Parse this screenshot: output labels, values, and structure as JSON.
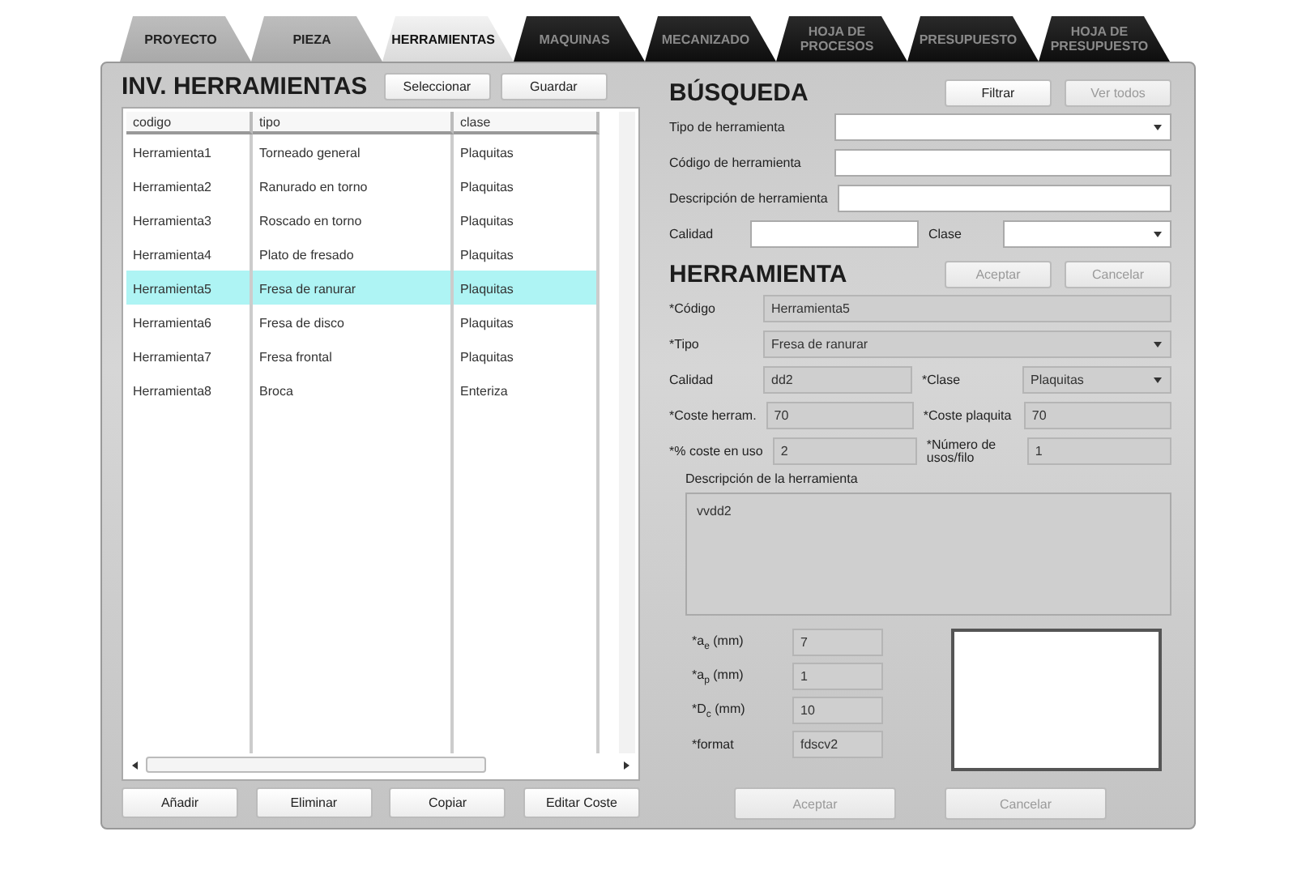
{
  "tabs": [
    {
      "label": "PROYECTO",
      "selected": false,
      "disabled": false
    },
    {
      "label": "PIEZA",
      "selected": false,
      "disabled": false
    },
    {
      "label": "HERRAMIENTAS",
      "selected": true,
      "disabled": false
    },
    {
      "label": "MAQUINAS",
      "selected": false,
      "disabled": true
    },
    {
      "label": "MECANIZADO",
      "selected": false,
      "disabled": true
    },
    {
      "label": "HOJA DE PROCESOS",
      "selected": false,
      "disabled": true
    },
    {
      "label": "PRESUPUESTO",
      "selected": false,
      "disabled": true
    },
    {
      "label": "HOJA DE PRESUPUESTO",
      "selected": false,
      "disabled": true
    }
  ],
  "inventory": {
    "title": "INV. HERRAMIENTAS",
    "buttons": [
      {
        "label": "Seleccionar"
      },
      {
        "label": "Guardar"
      }
    ],
    "table": {
      "columns": [
        "codigo",
        "tipo",
        "clase"
      ],
      "rows": [
        {
          "cells": [
            "Herramienta1",
            "Torneado general",
            "Plaquitas"
          ],
          "selected": false
        },
        {
          "cells": [
            "Herramienta2",
            "Ranurado en torno",
            "Plaquitas"
          ],
          "selected": false
        },
        {
          "cells": [
            "Herramienta3",
            "Roscado en torno",
            "Plaquitas"
          ],
          "selected": false
        },
        {
          "cells": [
            "Herramienta4",
            "Plato de fresado",
            "Plaquitas"
          ],
          "selected": false
        },
        {
          "cells": [
            "Herramienta5",
            "Fresa de ranurar",
            "Plaquitas"
          ],
          "selected": true
        },
        {
          "cells": [
            "Herramienta6",
            "Fresa de disco",
            "Plaquitas"
          ],
          "selected": false
        },
        {
          "cells": [
            "Herramienta7",
            "Fresa frontal",
            "Plaquitas"
          ],
          "selected": false
        },
        {
          "cells": [
            "Herramienta8",
            "Broca",
            "Enteriza"
          ],
          "selected": false
        }
      ]
    },
    "actions": [
      {
        "label": "Añadir"
      },
      {
        "label": "Eliminar"
      },
      {
        "label": "Copiar"
      },
      {
        "label": "Editar Coste"
      }
    ]
  },
  "search": {
    "title": "BÚSQUEDA",
    "buttons": [
      {
        "label": "Filtrar",
        "disabled": false
      },
      {
        "label": "Ver todos",
        "disabled": true
      }
    ],
    "rows": [
      {
        "fields": [
          {
            "label": "Tipo de herramienta",
            "kind": "select"
          }
        ]
      },
      {
        "fields": [
          {
            "label": "Código de herramienta",
            "kind": "text"
          }
        ]
      },
      {
        "fields": [
          {
            "label": "Descripción de herramienta",
            "kind": "text"
          }
        ]
      },
      {
        "fields": [
          {
            "label": "Calidad",
            "kind": "text"
          },
          {
            "label": "Clase",
            "kind": "select"
          }
        ]
      }
    ]
  },
  "tool": {
    "title": "HERRAMIENTA",
    "buttons": [
      {
        "label": "Aceptar",
        "disabled": true
      },
      {
        "label": "Cancelar",
        "disabled": true
      }
    ],
    "rows": [
      {
        "fields": [
          {
            "label": "*Código",
            "value": "Herramienta5",
            "kind": "text"
          }
        ]
      },
      {
        "fields": [
          {
            "label": "*Tipo",
            "value": "Fresa de ranurar",
            "kind": "select"
          }
        ]
      },
      {
        "fields": [
          {
            "label": "Calidad",
            "value": "dd2",
            "kind": "text"
          },
          {
            "label": "*Clase",
            "value": "Plaquitas",
            "kind": "select"
          }
        ]
      },
      {
        "fields": [
          {
            "label": "*Coste herram.",
            "value": "70",
            "kind": "text"
          },
          {
            "label": "*Coste plaquita",
            "value": "70",
            "kind": "text"
          }
        ]
      },
      {
        "fields": [
          {
            "label": "*% coste en uso",
            "value": "2",
            "kind": "text"
          },
          {
            "label": "*Número de usos/filo",
            "value": "1",
            "kind": "text"
          }
        ]
      }
    ],
    "description": {
      "label": "Descripción de la herramienta",
      "value": "vvdd2"
    },
    "params": [
      {
        "label": "*a$_{e}$ (mm)",
        "value": "7"
      },
      {
        "label": "*a$_{p}$ (mm)",
        "value": "1"
      },
      {
        "label": "*D$_{c}$ (mm)",
        "value": "10"
      },
      {
        "label": "*format",
        "value": "fdscv2"
      }
    ],
    "footer": [
      {
        "label": "Aceptar",
        "disabled": true
      },
      {
        "label": "Cancelar",
        "disabled": true
      }
    ]
  }
}
